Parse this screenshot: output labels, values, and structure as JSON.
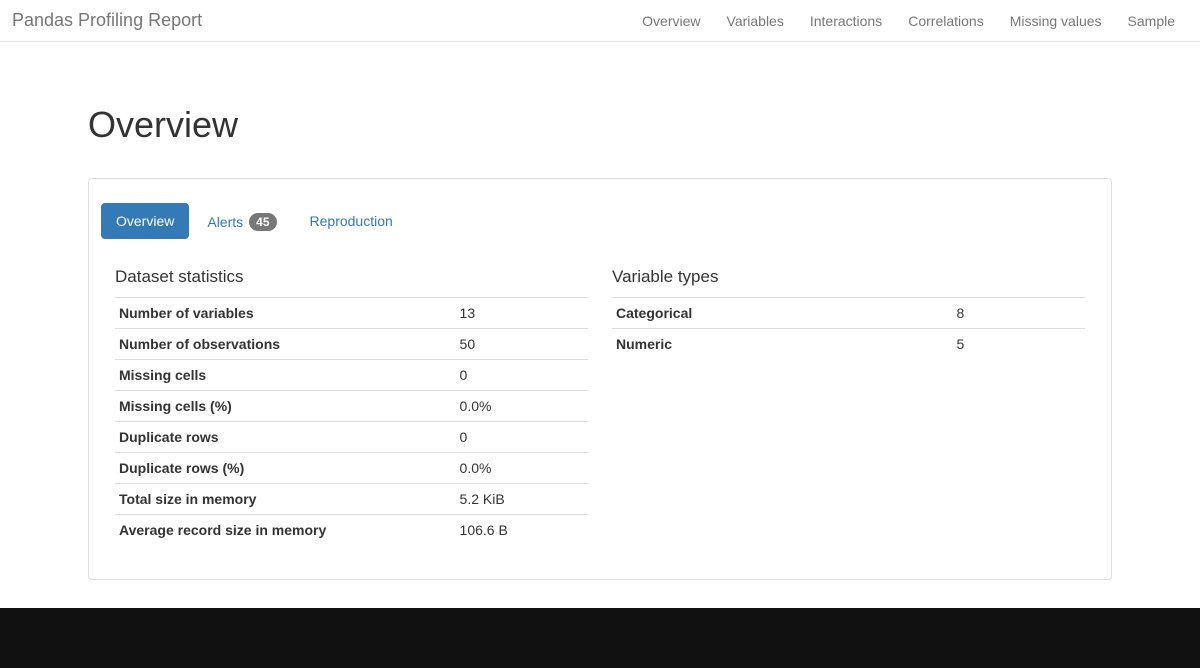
{
  "navbar": {
    "brand": "Pandas Profiling Report",
    "items": [
      "Overview",
      "Variables",
      "Interactions",
      "Correlations",
      "Missing values",
      "Sample"
    ]
  },
  "page": {
    "heading": "Overview"
  },
  "tabs": {
    "overview": "Overview",
    "alerts": "Alerts",
    "alerts_badge": "45",
    "reproduction": "Reproduction"
  },
  "dataset_stats": {
    "heading": "Dataset statistics",
    "rows": [
      {
        "label": "Number of variables",
        "value": "13"
      },
      {
        "label": "Number of observations",
        "value": "50"
      },
      {
        "label": "Missing cells",
        "value": "0"
      },
      {
        "label": "Missing cells (%)",
        "value": "0.0%"
      },
      {
        "label": "Duplicate rows",
        "value": "0"
      },
      {
        "label": "Duplicate rows (%)",
        "value": "0.0%"
      },
      {
        "label": "Total size in memory",
        "value": "5.2 KiB"
      },
      {
        "label": "Average record size in memory",
        "value": "106.6 B"
      }
    ]
  },
  "variable_types": {
    "heading": "Variable types",
    "rows": [
      {
        "label": "Categorical",
        "value": "8"
      },
      {
        "label": "Numeric",
        "value": "5"
      }
    ]
  }
}
